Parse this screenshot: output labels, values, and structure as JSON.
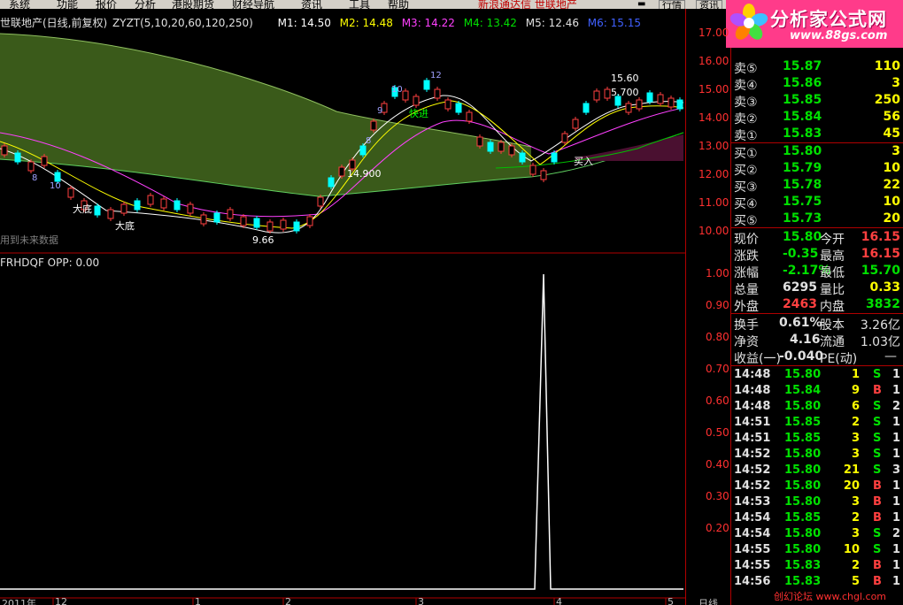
{
  "menu": {
    "items": [
      "系统",
      "功能",
      "报价",
      "分析",
      "港股期货",
      "财经导航",
      "资讯",
      "工具",
      "帮助"
    ],
    "notice": "新浪通达信 世联地产",
    "tab_quote": "行情",
    "tab_info": "资讯"
  },
  "logo": {
    "brand": "分析家公式网",
    "url": "www.88gs.com"
  },
  "chart": {
    "header": {
      "stock": "世联地产(日线,前复权)",
      "indicator": "ZYZT(5,10,20,60,120,250)",
      "m1": "M1: 14.50",
      "m2": "M2: 14.48",
      "m3": "M3: 14.22",
      "m4": "M4: 13.42",
      "m5": "M5: 12.46",
      "m6": "M6: 15.15"
    },
    "future_data_note": "用到未来数据",
    "sub_header": "FRHDQF OPP: 0.00",
    "annotations": {
      "high": "15.60",
      "low": "9.66",
      "mid": "14.900",
      "right_mid": "5.700",
      "bottom1": "大底",
      "bottom2": "大底",
      "buy": "买入",
      "fast": "快进"
    },
    "date_labels": [
      "2011年",
      "12",
      "1",
      "2",
      "3",
      "4",
      "5"
    ],
    "period": "日线",
    "wave_labels": [
      "8",
      "9",
      "10",
      "12",
      "8",
      "10"
    ],
    "colors": {
      "up": "#ff4040",
      "down": "#00ffff",
      "ma_white": "#ffffff",
      "ma_yellow": "#ffff00",
      "ma_magenta": "#ff40ff",
      "ma_green": "#00c000",
      "band": "#3a5a1a"
    }
  },
  "axis": {
    "main": [
      "17.00",
      "16.00",
      "15.00",
      "14.00",
      "13.00",
      "12.00",
      "11.00",
      "10.00"
    ],
    "sub": [
      "1.00",
      "0.90",
      "0.80",
      "0.70",
      "0.60",
      "0.50",
      "0.40",
      "0.30",
      "0.20"
    ]
  },
  "quote": {
    "asks": [
      {
        "label": "卖⑤",
        "price": "15.87",
        "vol": "110"
      },
      {
        "label": "卖④",
        "price": "15.86",
        "vol": "3"
      },
      {
        "label": "卖③",
        "price": "15.85",
        "vol": "250"
      },
      {
        "label": "卖②",
        "price": "15.84",
        "vol": "56"
      },
      {
        "label": "卖①",
        "price": "15.83",
        "vol": "45"
      }
    ],
    "bids": [
      {
        "label": "买①",
        "price": "15.80",
        "vol": "3"
      },
      {
        "label": "买②",
        "price": "15.79",
        "vol": "10"
      },
      {
        "label": "买③",
        "price": "15.78",
        "vol": "22"
      },
      {
        "label": "买④",
        "price": "15.75",
        "vol": "10"
      },
      {
        "label": "买⑤",
        "price": "15.73",
        "vol": "20"
      }
    ],
    "stats": [
      {
        "l1": "现价",
        "v1": "15.80",
        "c1": "green",
        "l2": "今开",
        "v2": "16.15",
        "c2": "red"
      },
      {
        "l1": "涨跌",
        "v1": "-0.35",
        "c1": "green",
        "l2": "最高",
        "v2": "16.15",
        "c2": "red"
      },
      {
        "l1": "涨幅",
        "v1": "-2.17%",
        "c1": "green",
        "l2": "最低",
        "v2": "15.70",
        "c2": "green"
      },
      {
        "l1": "总量",
        "v1": "6295",
        "c1": "white",
        "l2": "量比",
        "v2": "0.33",
        "c2": "yellow"
      },
      {
        "l1": "外盘",
        "v1": "2463",
        "c1": "red",
        "l2": "内盘",
        "v2": "3832",
        "c2": "green"
      }
    ],
    "fund": [
      {
        "l1": "换手",
        "v1": "0.61%",
        "l2": "股本",
        "v2": "3.26亿"
      },
      {
        "l1": "净资",
        "v1": "4.16",
        "l2": "流通",
        "v2": "1.03亿"
      },
      {
        "l1": "收益(一)",
        "v1": "-0.040",
        "l2": "PE(动)",
        "v2": "—"
      }
    ],
    "ticks": [
      {
        "time": "14:48",
        "price": "15.80",
        "vol": "1",
        "side": "S",
        "n": "1"
      },
      {
        "time": "14:48",
        "price": "15.84",
        "vol": "9",
        "side": "B",
        "n": "1"
      },
      {
        "time": "14:48",
        "price": "15.80",
        "vol": "6",
        "side": "S",
        "n": "2"
      },
      {
        "time": "14:51",
        "price": "15.85",
        "vol": "2",
        "side": "S",
        "n": "1"
      },
      {
        "time": "14:51",
        "price": "15.85",
        "vol": "3",
        "side": "S",
        "n": "1"
      },
      {
        "time": "14:52",
        "price": "15.80",
        "vol": "3",
        "side": "S",
        "n": "1"
      },
      {
        "time": "14:52",
        "price": "15.80",
        "vol": "21",
        "side": "S",
        "n": "3"
      },
      {
        "time": "14:52",
        "price": "15.80",
        "vol": "20",
        "side": "B",
        "n": "1"
      },
      {
        "time": "14:53",
        "price": "15.80",
        "vol": "3",
        "side": "B",
        "n": "1"
      },
      {
        "time": "14:54",
        "price": "15.85",
        "vol": "2",
        "side": "B",
        "n": "1"
      },
      {
        "time": "14:54",
        "price": "15.80",
        "vol": "3",
        "side": "S",
        "n": "2"
      },
      {
        "time": "14:55",
        "price": "15.80",
        "vol": "10",
        "side": "S",
        "n": "1"
      },
      {
        "time": "14:55",
        "price": "15.83",
        "vol": "2",
        "side": "B",
        "n": "1"
      },
      {
        "time": "14:56",
        "price": "15.83",
        "vol": "5",
        "side": "B",
        "n": "1"
      }
    ],
    "footer_link": "创幻论坛 www.chgl.com"
  }
}
